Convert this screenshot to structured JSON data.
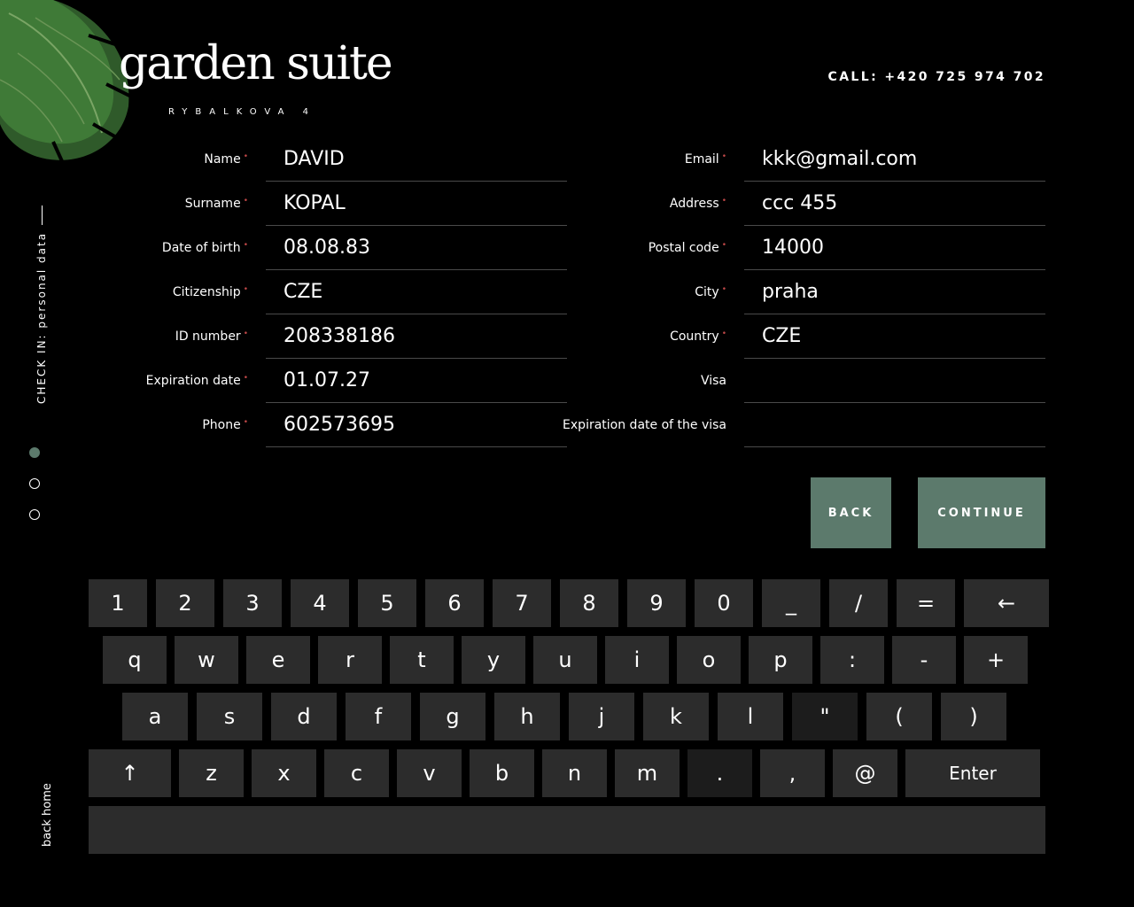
{
  "header": {
    "logo_title": "garden suite",
    "logo_subtitle": "RYBALKOVA 4",
    "call": "CALL: +420 725 974 702"
  },
  "sidebar": {
    "step_label": "CHECK IN: personal data",
    "back_home": "back home",
    "steps_total": 3,
    "current_step": 1
  },
  "form": {
    "left": [
      {
        "label": "Name",
        "value": "DAVID",
        "required": true
      },
      {
        "label": "Surname",
        "value": "KOPAL",
        "required": true
      },
      {
        "label": "Date of birth",
        "value": "08.08.83",
        "required": true
      },
      {
        "label": "Citizenship",
        "value": "CZE",
        "required": true
      },
      {
        "label": "ID number",
        "value": "208338186",
        "required": true
      },
      {
        "label": "Expiration date",
        "value": "01.07.27",
        "required": true
      },
      {
        "label": "Phone",
        "value": "602573695",
        "required": true
      }
    ],
    "right": [
      {
        "label": "Email",
        "value": "kkk@gmail.com",
        "required": true
      },
      {
        "label": "Address",
        "value": "ccc 455",
        "required": true
      },
      {
        "label": "Postal code",
        "value": "14000",
        "required": true
      },
      {
        "label": "City",
        "value": "praha",
        "required": true
      },
      {
        "label": "Country",
        "value": "CZE",
        "required": true
      },
      {
        "label": "Visa",
        "value": "",
        "required": false
      },
      {
        "label": "Expiration date of the visa",
        "value": "",
        "required": false
      }
    ]
  },
  "buttons": {
    "back": "BACK",
    "continue": "CONTINUE"
  },
  "keyboard": {
    "row1": [
      "1",
      "2",
      "3",
      "4",
      "5",
      "6",
      "7",
      "8",
      "9",
      "0",
      "_",
      "/",
      "=",
      "←"
    ],
    "row2": [
      "q",
      "w",
      "e",
      "r",
      "t",
      "y",
      "u",
      "i",
      "o",
      "p",
      ":",
      "-",
      "+"
    ],
    "row3": [
      "a",
      "s",
      "d",
      "f",
      "g",
      "h",
      "j",
      "k",
      "l",
      "\"",
      "(",
      ")"
    ],
    "row4": [
      "↑",
      "z",
      "x",
      "c",
      "v",
      "b",
      "n",
      "m",
      ".",
      ",",
      "@",
      "Enter"
    ]
  },
  "colors": {
    "accent": "#5c7a6c",
    "key": "#2c2c2c",
    "key_dark": "#1c1c1c",
    "required_mark": "#c04848",
    "background": "#000000"
  }
}
